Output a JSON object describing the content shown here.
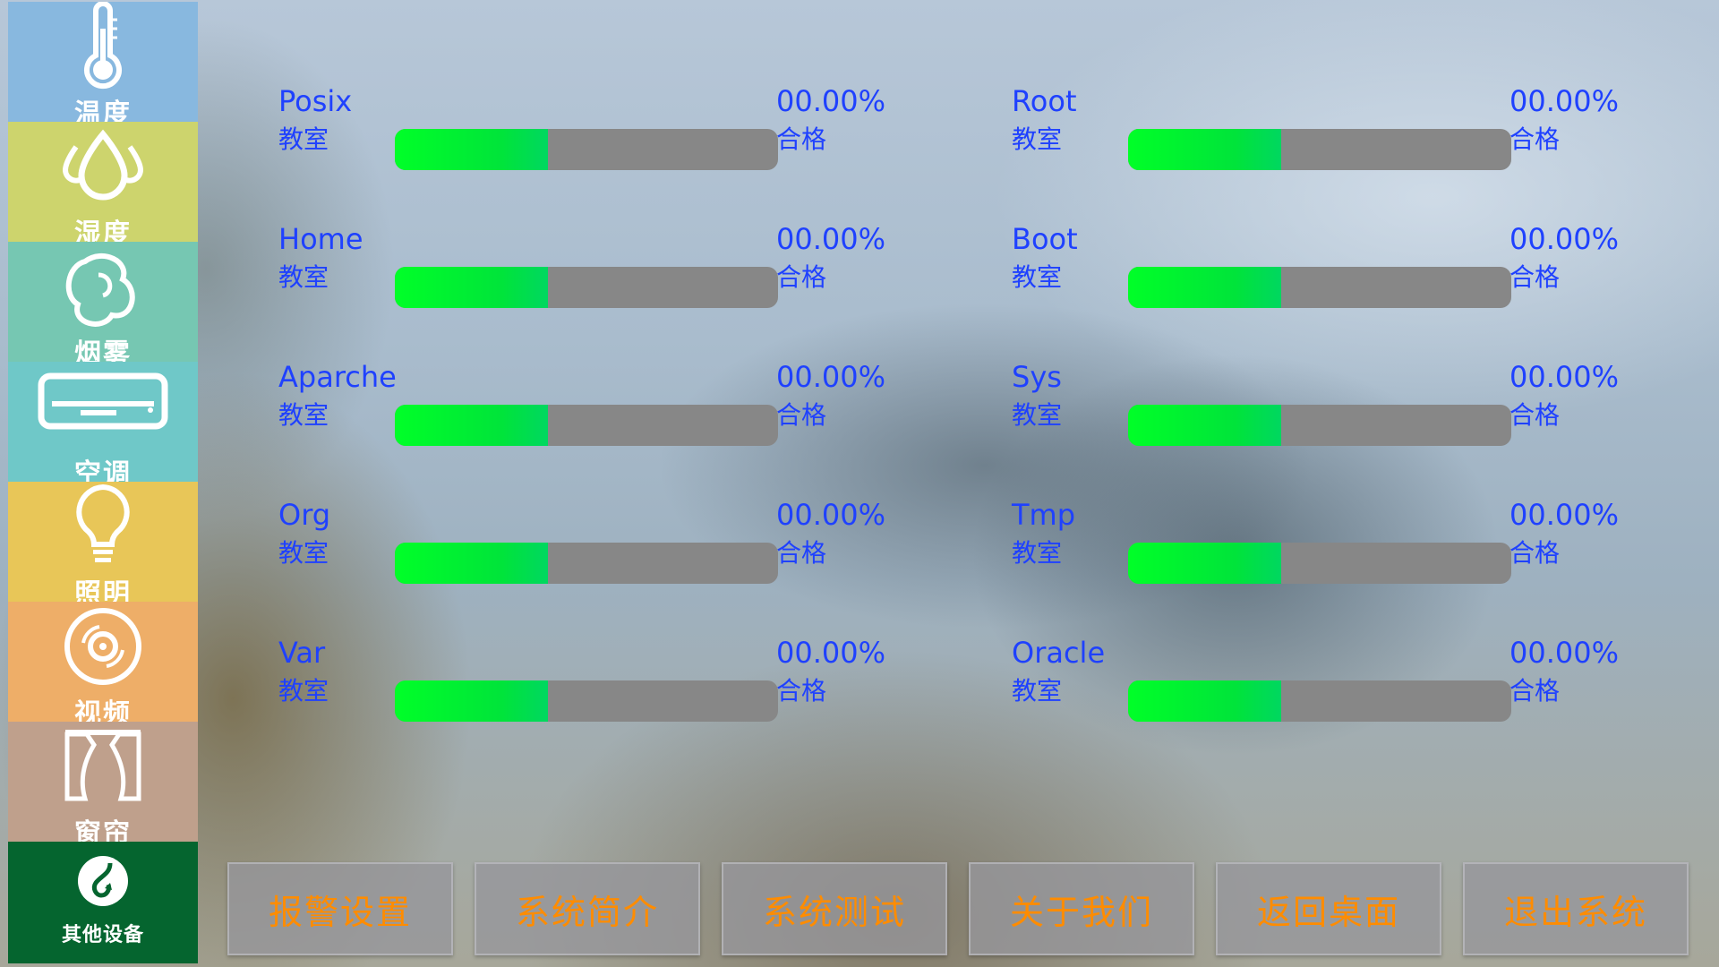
{
  "colors": {
    "text_blue": "#1f41ff",
    "button_text": "#ff8c00",
    "progress_fill": "#00ff28",
    "progress_track": "#878787"
  },
  "sidebar": {
    "items": [
      {
        "label": "温度",
        "icon": "thermometer-icon",
        "color": "#88b8df"
      },
      {
        "label": "湿度",
        "icon": "water-drops-icon",
        "color": "#cdd46d"
      },
      {
        "label": "烟雾",
        "icon": "smoke-swirl-icon",
        "color": "#76c7b2"
      },
      {
        "label": "空调",
        "icon": "air-conditioner-icon",
        "color": "#6fc8c8"
      },
      {
        "label": "照明",
        "icon": "light-bulb-icon",
        "color": "#e8c658"
      },
      {
        "label": "视频",
        "icon": "video-disc-icon",
        "color": "#eeae68"
      },
      {
        "label": "窗帘",
        "icon": "curtain-icon",
        "color": "#bfa08c"
      },
      {
        "label": "其他设备",
        "icon": "other-devices-icon",
        "color": "#05652f"
      }
    ]
  },
  "items": [
    {
      "name": "Posix",
      "room": "教室",
      "percent": "00.00%",
      "status": "合格",
      "fill": 0.4
    },
    {
      "name": "Root",
      "room": "教室",
      "percent": "00.00%",
      "status": "合格",
      "fill": 0.4
    },
    {
      "name": "Home",
      "room": "教室",
      "percent": "00.00%",
      "status": "合格",
      "fill": 0.4
    },
    {
      "name": "Boot",
      "room": "教室",
      "percent": "00.00%",
      "status": "合格",
      "fill": 0.4
    },
    {
      "name": "Aparche",
      "room": "教室",
      "percent": "00.00%",
      "status": "合格",
      "fill": 0.4
    },
    {
      "name": "Sys",
      "room": "教室",
      "percent": "00.00%",
      "status": "合格",
      "fill": 0.4
    },
    {
      "name": "Org",
      "room": "教室",
      "percent": "00.00%",
      "status": "合格",
      "fill": 0.4
    },
    {
      "name": "Tmp",
      "room": "教室",
      "percent": "00.00%",
      "status": "合格",
      "fill": 0.4
    },
    {
      "name": "Var",
      "room": "教室",
      "percent": "00.00%",
      "status": "合格",
      "fill": 0.4
    },
    {
      "name": "Oracle",
      "room": "教室",
      "percent": "00.00%",
      "status": "合格",
      "fill": 0.4
    }
  ],
  "buttons": [
    {
      "label": "报警设置"
    },
    {
      "label": "系统简介"
    },
    {
      "label": "系统测试"
    },
    {
      "label": "关于我们"
    },
    {
      "label": "返回桌面"
    },
    {
      "label": "退出系统"
    }
  ]
}
